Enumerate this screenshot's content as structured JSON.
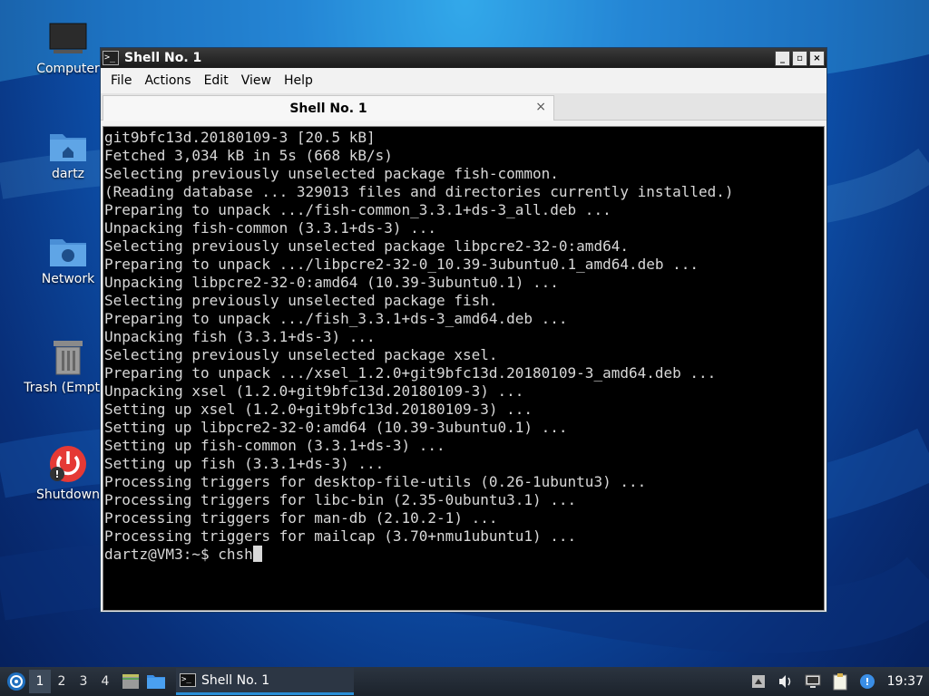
{
  "desktop": {
    "icons": [
      {
        "label": "Computer"
      },
      {
        "label": "dartz"
      },
      {
        "label": "Network"
      },
      {
        "label": "Trash (Empty)"
      },
      {
        "label": "Shutdown"
      }
    ]
  },
  "window": {
    "title": "Shell No. 1",
    "title_icon_glyph": ">_",
    "menu": [
      "File",
      "Actions",
      "Edit",
      "View",
      "Help"
    ],
    "tab_label": "Shell No. 1",
    "tab_close_glyph": "×",
    "buttons": {
      "minimize": "_",
      "maximize": "▫",
      "close": "×"
    }
  },
  "terminal": {
    "lines": [
      "git9bfc13d.20180109-3 [20.5 kB]",
      "Fetched 3,034 kB in 5s (668 kB/s)",
      "Selecting previously unselected package fish-common.",
      "(Reading database ... 329013 files and directories currently installed.)",
      "Preparing to unpack .../fish-common_3.3.1+ds-3_all.deb ...",
      "Unpacking fish-common (3.3.1+ds-3) ...",
      "Selecting previously unselected package libpcre2-32-0:amd64.",
      "Preparing to unpack .../libpcre2-32-0_10.39-3ubuntu0.1_amd64.deb ...",
      "Unpacking libpcre2-32-0:amd64 (10.39-3ubuntu0.1) ...",
      "Selecting previously unselected package fish.",
      "Preparing to unpack .../fish_3.3.1+ds-3_amd64.deb ...",
      "Unpacking fish (3.3.1+ds-3) ...",
      "Selecting previously unselected package xsel.",
      "Preparing to unpack .../xsel_1.2.0+git9bfc13d.20180109-3_amd64.deb ...",
      "Unpacking xsel (1.2.0+git9bfc13d.20180109-3) ...",
      "Setting up xsel (1.2.0+git9bfc13d.20180109-3) ...",
      "Setting up libpcre2-32-0:amd64 (10.39-3ubuntu0.1) ...",
      "Setting up fish-common (3.3.1+ds-3) ...",
      "Setting up fish (3.3.1+ds-3) ...",
      "Processing triggers for desktop-file-utils (0.26-1ubuntu3) ...",
      "Processing triggers for libc-bin (2.35-0ubuntu3.1) ...",
      "Processing triggers for man-db (2.10.2-1) ...",
      "Processing triggers for mailcap (3.70+nmu1ubuntu1) ..."
    ],
    "prompt": "dartz@VM3:~$ ",
    "command": "chsh"
  },
  "taskbar": {
    "workspaces": [
      "1",
      "2",
      "3",
      "4"
    ],
    "active_workspace": "1",
    "task_label": "Shell No. 1",
    "clock": "19:37"
  }
}
